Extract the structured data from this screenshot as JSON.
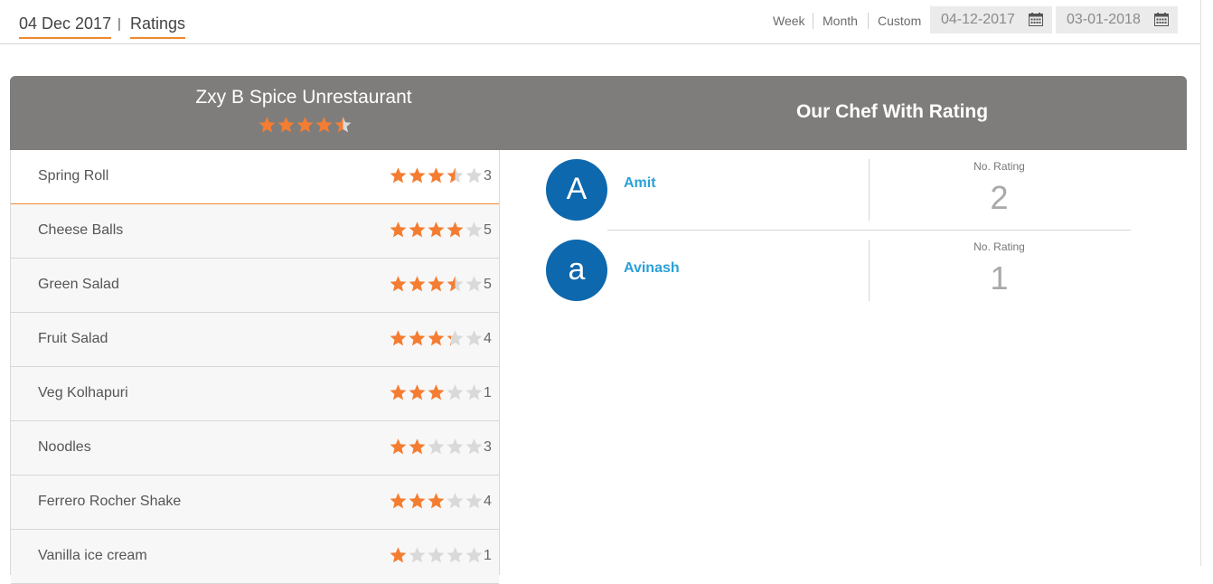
{
  "breadcrumb": {
    "date": "04 Dec 2017",
    "separator": "|",
    "page": "Ratings"
  },
  "range": {
    "options": [
      "Week",
      "Month",
      "Custom"
    ],
    "from_date": "04-12-2017",
    "to_date": "03-01-2018",
    "calendar_icon": "calendar-icon"
  },
  "colors": {
    "accent": "#f0892f",
    "star_filled": "#f47d31",
    "star_empty": "#d9d9d9",
    "header_bg": "#7f7d7b",
    "avatar_bg": "#0e68ad",
    "chef_name": "#2aa0d7"
  },
  "restaurant": {
    "name": "Zxy B Spice Unrestaurant",
    "rating": 4.5
  },
  "chef_section": {
    "title": "Our Chef With Rating"
  },
  "menu_items": [
    {
      "name": "Spring Roll",
      "rating": 3.5,
      "count": "3"
    },
    {
      "name": "Cheese Balls",
      "rating": 4,
      "count": "5"
    },
    {
      "name": "Green Salad",
      "rating": 3.5,
      "count": "5"
    },
    {
      "name": "Fruit Salad",
      "rating": 3.25,
      "count": "4"
    },
    {
      "name": "Veg Kolhapuri",
      "rating": 3,
      "count": "1"
    },
    {
      "name": "Noodles",
      "rating": 2,
      "count": "3"
    },
    {
      "name": "Ferrero Rocher Shake",
      "rating": 3,
      "count": "4"
    },
    {
      "name": "Vanilla ice cream",
      "rating": 1,
      "count": "1"
    }
  ],
  "chefs": [
    {
      "initial": "A",
      "name": "Amit",
      "rating_label": "No. Rating",
      "rating_count": "2"
    },
    {
      "initial": "a",
      "name": "Avinash",
      "rating_label": "No. Rating",
      "rating_count": "1"
    }
  ]
}
